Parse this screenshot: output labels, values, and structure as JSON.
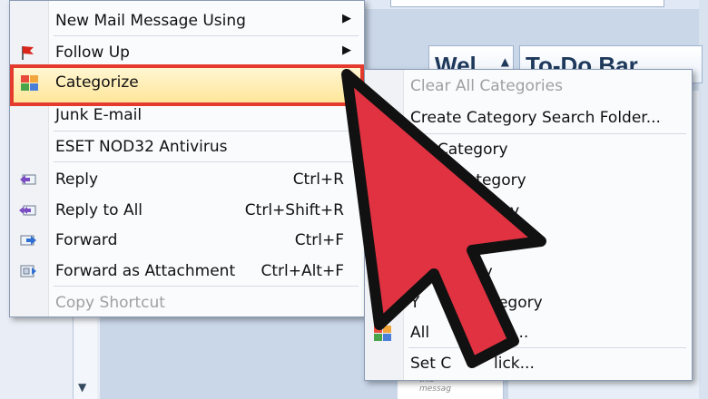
{
  "left_menu": {
    "items": [
      {
        "label": "New Mail Message Using",
        "submenu": true
      },
      {
        "label": "Follow Up",
        "submenu": true
      },
      {
        "label": "Categorize"
      },
      {
        "label": "Junk E-mail"
      },
      {
        "label": "ESET NOD32 Antivirus"
      },
      {
        "label": "Reply",
        "shortcut": "Ctrl+R"
      },
      {
        "label": "Reply to All",
        "shortcut": "Ctrl+Shift+R"
      },
      {
        "label": "Forward",
        "shortcut": "Ctrl+F"
      },
      {
        "label": "Forward as Attachment",
        "shortcut": "Ctrl+Alt+F"
      },
      {
        "label": "Copy Shortcut",
        "disabled": true
      }
    ],
    "submenu_glyph": "▶"
  },
  "right_menu": {
    "items": [
      {
        "label": "Clear All Categories",
        "disabled": true
      },
      {
        "label": "Create Category Search Folder..."
      },
      {
        "label": "e Category"
      },
      {
        "label": "Category"
      },
      {
        "label": "gory"
      },
      {
        "label": "egory"
      },
      {
        "label": "Y",
        "label_tail": "Category"
      },
      {
        "label": "All",
        "label_tail": "ies..."
      },
      {
        "label": "Set C",
        "label_tail": "lick..."
      }
    ]
  },
  "background": {
    "pane_wel_title": "Wel",
    "pane_todo_title": "To-Do Bar",
    "message_text_line1": "this",
    "message_text_line2": "messag"
  },
  "colors": {
    "highlight_border": "#e53b2f",
    "arrow_fill": "#e03241",
    "arrow_outline": "#111111"
  },
  "icons": {
    "follow_up": "red-flag-icon",
    "categorize": "color-categories-icon",
    "reply": "reply-icon",
    "reply_all": "reply-all-icon",
    "forward": "forward-icon",
    "forward_attachment": "forward-attachment-icon",
    "arrow": "pointer-arrow-icon"
  }
}
